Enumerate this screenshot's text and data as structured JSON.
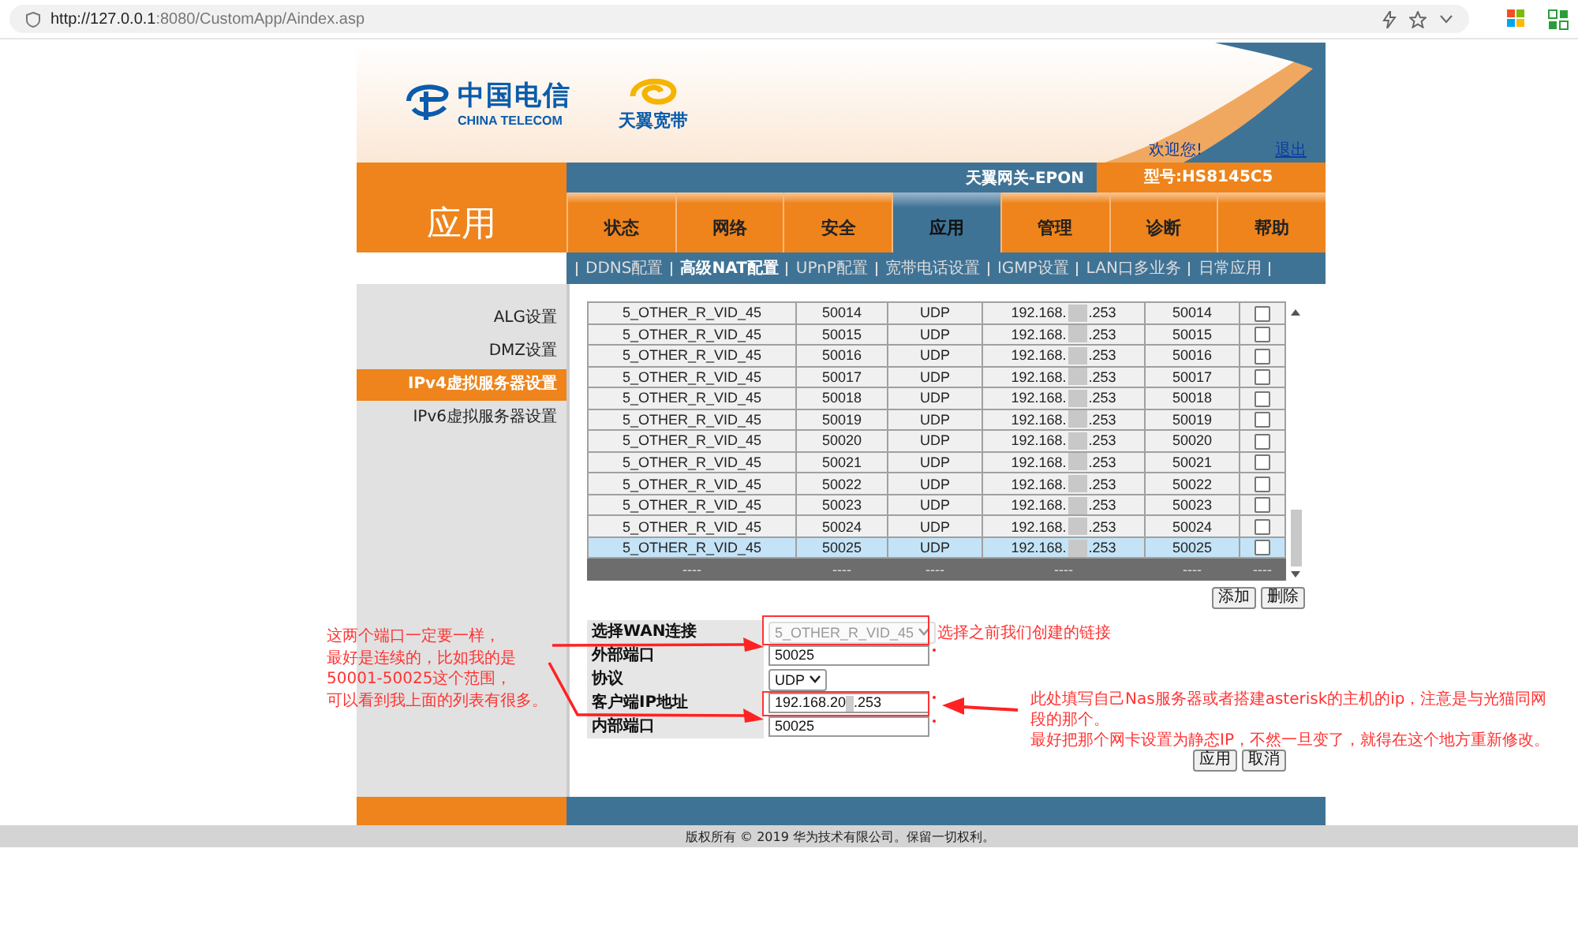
{
  "browser": {
    "url_host": "http://127.0.0.1",
    "url_rest": ":8080/CustomApp/Aindex.asp"
  },
  "header": {
    "brand_cn": "中国电信",
    "brand_en": "CHINA TELECOM",
    "brand2": "天翼宽带",
    "welcome": "欢迎您!",
    "logout": "退出"
  },
  "section_title": "应用",
  "gateway": "天翼网关-EPON",
  "model": "型号:HS8145C5",
  "tabs": [
    {
      "label": "状态",
      "selected": false
    },
    {
      "label": "网络",
      "selected": false
    },
    {
      "label": "安全",
      "selected": false
    },
    {
      "label": "应用",
      "selected": true
    },
    {
      "label": "管理",
      "selected": false
    },
    {
      "label": "诊断",
      "selected": false
    },
    {
      "label": "帮助",
      "selected": false
    }
  ],
  "subtabs": [
    {
      "label": "DDNS配置",
      "selected": false
    },
    {
      "label": "高级NAT配置",
      "selected": true
    },
    {
      "label": "UPnP配置",
      "selected": false
    },
    {
      "label": "宽带电话设置",
      "selected": false
    },
    {
      "label": "IGMP设置",
      "selected": false
    },
    {
      "label": "LAN口多业务",
      "selected": false
    },
    {
      "label": "日常应用",
      "selected": false
    }
  ],
  "sidebar": {
    "items": [
      {
        "label": "ALG设置",
        "selected": false
      },
      {
        "label": "DMZ设置",
        "selected": false
      },
      {
        "label": "IPv4虚拟服务器设置",
        "selected": true
      },
      {
        "label": "IPv6虚拟服务器设置",
        "selected": false
      }
    ]
  },
  "table": {
    "rows": [
      {
        "wan": "5_OTHER_R_VID_45",
        "ext_port": "50014",
        "protocol": "UDP",
        "ip_start": "192.168.",
        "ip_end": ".253",
        "int_port": "50014",
        "checked": false,
        "selected": false
      },
      {
        "wan": "5_OTHER_R_VID_45",
        "ext_port": "50015",
        "protocol": "UDP",
        "ip_start": "192.168.",
        "ip_end": ".253",
        "int_port": "50015",
        "checked": false,
        "selected": false
      },
      {
        "wan": "5_OTHER_R_VID_45",
        "ext_port": "50016",
        "protocol": "UDP",
        "ip_start": "192.168.",
        "ip_end": ".253",
        "int_port": "50016",
        "checked": false,
        "selected": false
      },
      {
        "wan": "5_OTHER_R_VID_45",
        "ext_port": "50017",
        "protocol": "UDP",
        "ip_start": "192.168.",
        "ip_end": ".253",
        "int_port": "50017",
        "checked": false,
        "selected": false
      },
      {
        "wan": "5_OTHER_R_VID_45",
        "ext_port": "50018",
        "protocol": "UDP",
        "ip_start": "192.168.",
        "ip_end": ".253",
        "int_port": "50018",
        "checked": false,
        "selected": false
      },
      {
        "wan": "5_OTHER_R_VID_45",
        "ext_port": "50019",
        "protocol": "UDP",
        "ip_start": "192.168.",
        "ip_end": ".253",
        "int_port": "50019",
        "checked": false,
        "selected": false
      },
      {
        "wan": "5_OTHER_R_VID_45",
        "ext_port": "50020",
        "protocol": "UDP",
        "ip_start": "192.168.",
        "ip_end": ".253",
        "int_port": "50020",
        "checked": false,
        "selected": false
      },
      {
        "wan": "5_OTHER_R_VID_45",
        "ext_port": "50021",
        "protocol": "UDP",
        "ip_start": "192.168.",
        "ip_end": ".253",
        "int_port": "50021",
        "checked": false,
        "selected": false
      },
      {
        "wan": "5_OTHER_R_VID_45",
        "ext_port": "50022",
        "protocol": "UDP",
        "ip_start": "192.168.",
        "ip_end": ".253",
        "int_port": "50022",
        "checked": false,
        "selected": false
      },
      {
        "wan": "5_OTHER_R_VID_45",
        "ext_port": "50023",
        "protocol": "UDP",
        "ip_start": "192.168.",
        "ip_end": ".253",
        "int_port": "50023",
        "checked": false,
        "selected": false
      },
      {
        "wan": "5_OTHER_R_VID_45",
        "ext_port": "50024",
        "protocol": "UDP",
        "ip_start": "192.168.",
        "ip_end": ".253",
        "int_port": "50024",
        "checked": false,
        "selected": false
      },
      {
        "wan": "5_OTHER_R_VID_45",
        "ext_port": "50025",
        "protocol": "UDP",
        "ip_start": "192.168.",
        "ip_end": ".253",
        "int_port": "50025",
        "checked": false,
        "selected": true
      }
    ],
    "footer": [
      "----",
      "----",
      "----",
      "----",
      "----",
      "----"
    ]
  },
  "table_buttons": [
    "添加",
    "删除"
  ],
  "form": [
    {
      "kind": "select",
      "label": "选择WAN连接",
      "value": "5_OTHER_R_VID_45",
      "disabled": true
    },
    {
      "kind": "input",
      "label": "外部端口",
      "value": "50025",
      "required": true
    },
    {
      "kind": "select",
      "label": "协议",
      "value": "UDP",
      "disabled": false
    },
    {
      "kind": "ip",
      "label": "客户端IP地址",
      "value_start": "192.168.20",
      "value_end": ".253",
      "required": true
    },
    {
      "kind": "input",
      "label": "内部端口",
      "value": "50025",
      "required": true
    }
  ],
  "form_buttons": [
    "应用",
    "取消"
  ],
  "copyright": "版权所有 © 2019 华为技术有限公司。保留一切权利。",
  "annotations": {
    "left": [
      "这两个端口一定要一样，",
      "最好是连续的，比如我的是",
      "50001-50025这个范围，",
      "可以看到我上面的列表有很多。"
    ],
    "select_note": "选择之前我们创建的链接",
    "ip_note": [
      "此处填写自己Nas服务器或者搭建asterisk的主机的ip，注意是与光猫同网",
      "段的那个。",
      "最好把那个网卡设置为静态IP，不然一旦变了，就得在这个地方重新修改。"
    ]
  }
}
